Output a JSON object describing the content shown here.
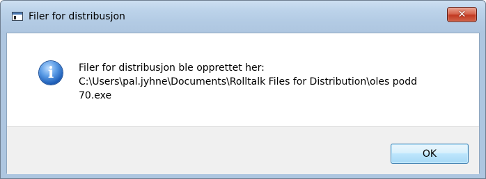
{
  "window": {
    "title": "Filer for distribusjon",
    "title_icon": "application-window-icon",
    "close_glyph": "✕"
  },
  "message": {
    "icon": "info-icon",
    "icon_glyph": "i",
    "line1": "Filer for distribusjon ble opprettet her:",
    "line2": "C:\\Users\\pal.jyhne\\Documents\\Rolltalk Files for Distribution\\oles podd",
    "line3": "70.exe"
  },
  "buttons": {
    "ok_label": "OK"
  }
}
